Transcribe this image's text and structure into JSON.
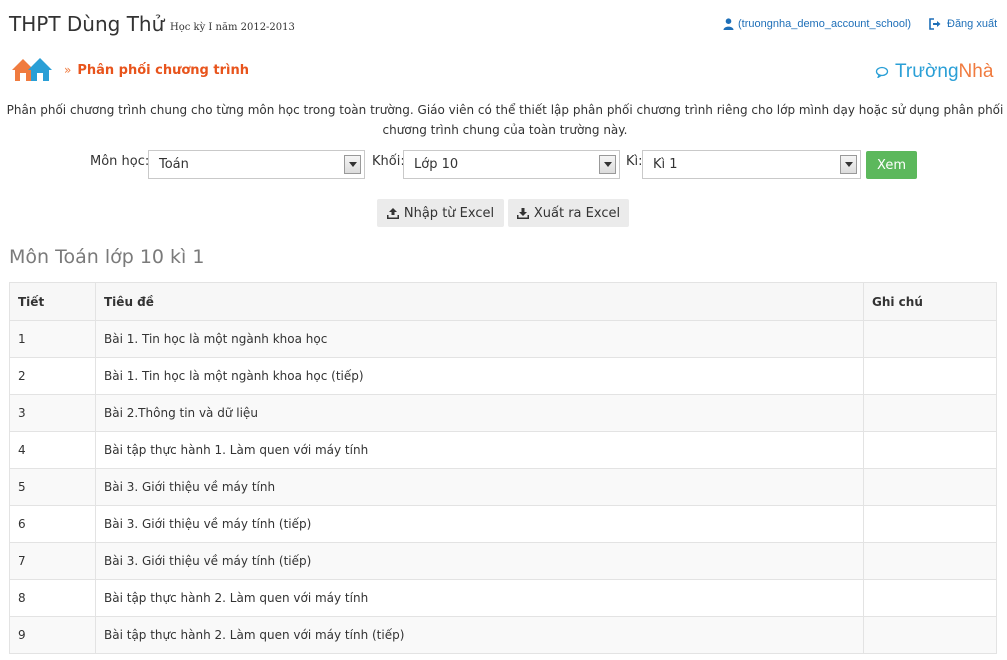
{
  "header": {
    "school_name": "THPT Dùng Thử",
    "semester": "Học kỳ I năm 2012-2013",
    "user": "(truongnha_demo_account_school)",
    "logout": "Đăng xuất",
    "user_icon": "user-icon",
    "logout_icon": "sign-out-icon"
  },
  "breadcrumb": {
    "separator": "»",
    "current": "Phân phối chương trình",
    "home_icon": "home-icon"
  },
  "brand": {
    "part1": "Trường",
    "part2": "Nhà",
    "icon": "chat-bubble-icon",
    "colors": {
      "blue": "#2a9fd6",
      "orange": "#f07b3f"
    }
  },
  "description": "Phân phối chương trình chung cho từng môn học trong toàn trường. Giáo viên có thể thiết lập phân phối chương trình riêng cho lớp mình dạy hoặc sử dụng phân phối chương trình chung của toàn trường này.",
  "filters": {
    "subject_label": "Môn học:",
    "subject_value": "Toán",
    "grade_label": "Khối:",
    "grade_value": "Lớp 10",
    "term_label": "Kì:",
    "term_value": "Kì 1",
    "view_button": "Xem"
  },
  "actions": {
    "import_excel": "Nhập từ Excel",
    "export_excel": "Xuất ra Excel",
    "import_icon": "upload-icon",
    "export_icon": "download-icon"
  },
  "section_title": "Môn Toán lớp 10 kì 1",
  "table": {
    "headers": [
      "Tiết",
      "Tiêu đề",
      "Ghi chú"
    ],
    "rows": [
      [
        "1",
        "Bài 1. Tin học là một ngành khoa học",
        ""
      ],
      [
        "2",
        "Bài 1. Tin học là một ngành khoa học (tiếp)",
        ""
      ],
      [
        "3",
        "Bài 2.Thông tin và dữ liệu",
        ""
      ],
      [
        "4",
        "Bài tập thực hành 1. Làm quen với máy tính",
        ""
      ],
      [
        "5",
        "Bài 3. Giới thiệu về máy tính",
        ""
      ],
      [
        "6",
        "Bài 3. Giới thiệu về máy tính (tiếp)",
        ""
      ],
      [
        "7",
        "Bài 3. Giới thiệu về máy tính (tiếp)",
        ""
      ],
      [
        "8",
        "Bài tập thực hành 2. Làm quen với máy tính",
        ""
      ],
      [
        "9",
        "Bài tập thực hành 2. Làm quen với máy tính (tiếp)",
        ""
      ]
    ]
  },
  "colors": {
    "accent_orange": "#e8541c",
    "link_blue": "#1e6fb8",
    "button_green": "#5cb85c"
  }
}
